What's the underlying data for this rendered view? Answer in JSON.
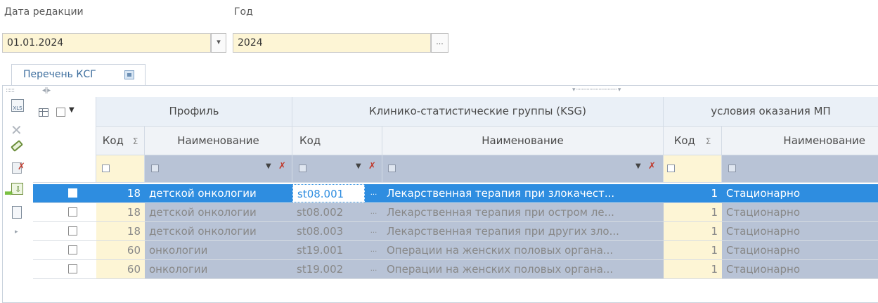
{
  "form": {
    "edition_date_label": "Дата редакции",
    "edition_date_value": "01.01.2024",
    "year_label": "Год",
    "year_value": "2024",
    "dropdown_glyph": "▾",
    "ellipsis_glyph": "..."
  },
  "tab": {
    "label": "Перечень КСГ"
  },
  "grid": {
    "groups": {
      "profile": "Профиль",
      "ksg": "Клинико-статистические группы (KSG)",
      "conditions": "условия оказания МП"
    },
    "columns": {
      "profile_code": "Код",
      "profile_name": "Наименование",
      "ksg_code": "Код",
      "ksg_name": "Наименование",
      "cond_code": "Код",
      "cond_name": "Наименование"
    },
    "rows": [
      {
        "profile_code": "18",
        "profile_name": "детской онкологии",
        "ksg_code": "st08.001",
        "ksg_name": "Лекарственная терапия при злокачест...",
        "cond_code": "1",
        "cond_name": "Стационарно",
        "selected": true
      },
      {
        "profile_code": "18",
        "profile_name": "детской онкологии",
        "ksg_code": "st08.002",
        "ksg_name": "Лекарственная терапия при остром ле...",
        "cond_code": "1",
        "cond_name": "Стационарно",
        "selected": false
      },
      {
        "profile_code": "18",
        "profile_name": "детской онкологии",
        "ksg_code": "st08.003",
        "ksg_name": "Лекарственная терапия при других зло...",
        "cond_code": "1",
        "cond_name": "Стационарно",
        "selected": false
      },
      {
        "profile_code": "60",
        "profile_name": "онкологии",
        "ksg_code": "st19.001",
        "ksg_name": "Операции на женских половых органа...",
        "cond_code": "1",
        "cond_name": "Стационарно",
        "selected": false
      },
      {
        "profile_code": "60",
        "profile_name": "онкологии",
        "ksg_code": "st19.002",
        "ksg_name": "Операции на женских половых органа...",
        "cond_code": "1",
        "cond_name": "Стационарно",
        "selected": false
      }
    ]
  },
  "colors": {
    "accent": "#2e8de0",
    "field_bg": "#fdf5d5",
    "header_bg": "#eaf0f7",
    "row_arrow": "#7bc142"
  }
}
